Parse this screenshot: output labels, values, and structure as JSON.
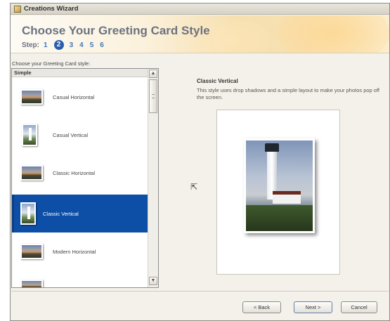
{
  "window": {
    "title": "Creations Wizard"
  },
  "banner": {
    "heading": "Choose Your Greeting Card Style",
    "step_label": "Step:",
    "steps": [
      "1",
      "2",
      "3",
      "4",
      "5",
      "6"
    ],
    "active_step": "2"
  },
  "chooser": {
    "prompt": "Choose your Greeting Card style:",
    "group": "Simple",
    "items": [
      {
        "label": "Casual Horizontal",
        "thumb": "horizontal-photo"
      },
      {
        "label": "Casual Vertical",
        "thumb": "vertical-photo"
      },
      {
        "label": "Classic Horizontal",
        "thumb": "horizontal-photo"
      },
      {
        "label": "Classic Vertical",
        "thumb": "vertical-photo",
        "selected": true
      },
      {
        "label": "Modern Horizontal",
        "thumb": "horizontal-photo"
      },
      {
        "label": "",
        "thumb": "horizontal-photo"
      }
    ]
  },
  "detail": {
    "title": "Classic Vertical",
    "description": "This style uses drop shadows and a simple layout to make your photos pop off the screen."
  },
  "buttons": {
    "back": "< Back",
    "next": "Next >",
    "cancel": "Cancel"
  },
  "colors": {
    "selection": "#0d4ea6",
    "step_active": "#2b5fae",
    "heading": "#6c7380"
  },
  "icons": {
    "scroll_up": "▲",
    "scroll_down": "▼",
    "cursor": "⇱"
  }
}
